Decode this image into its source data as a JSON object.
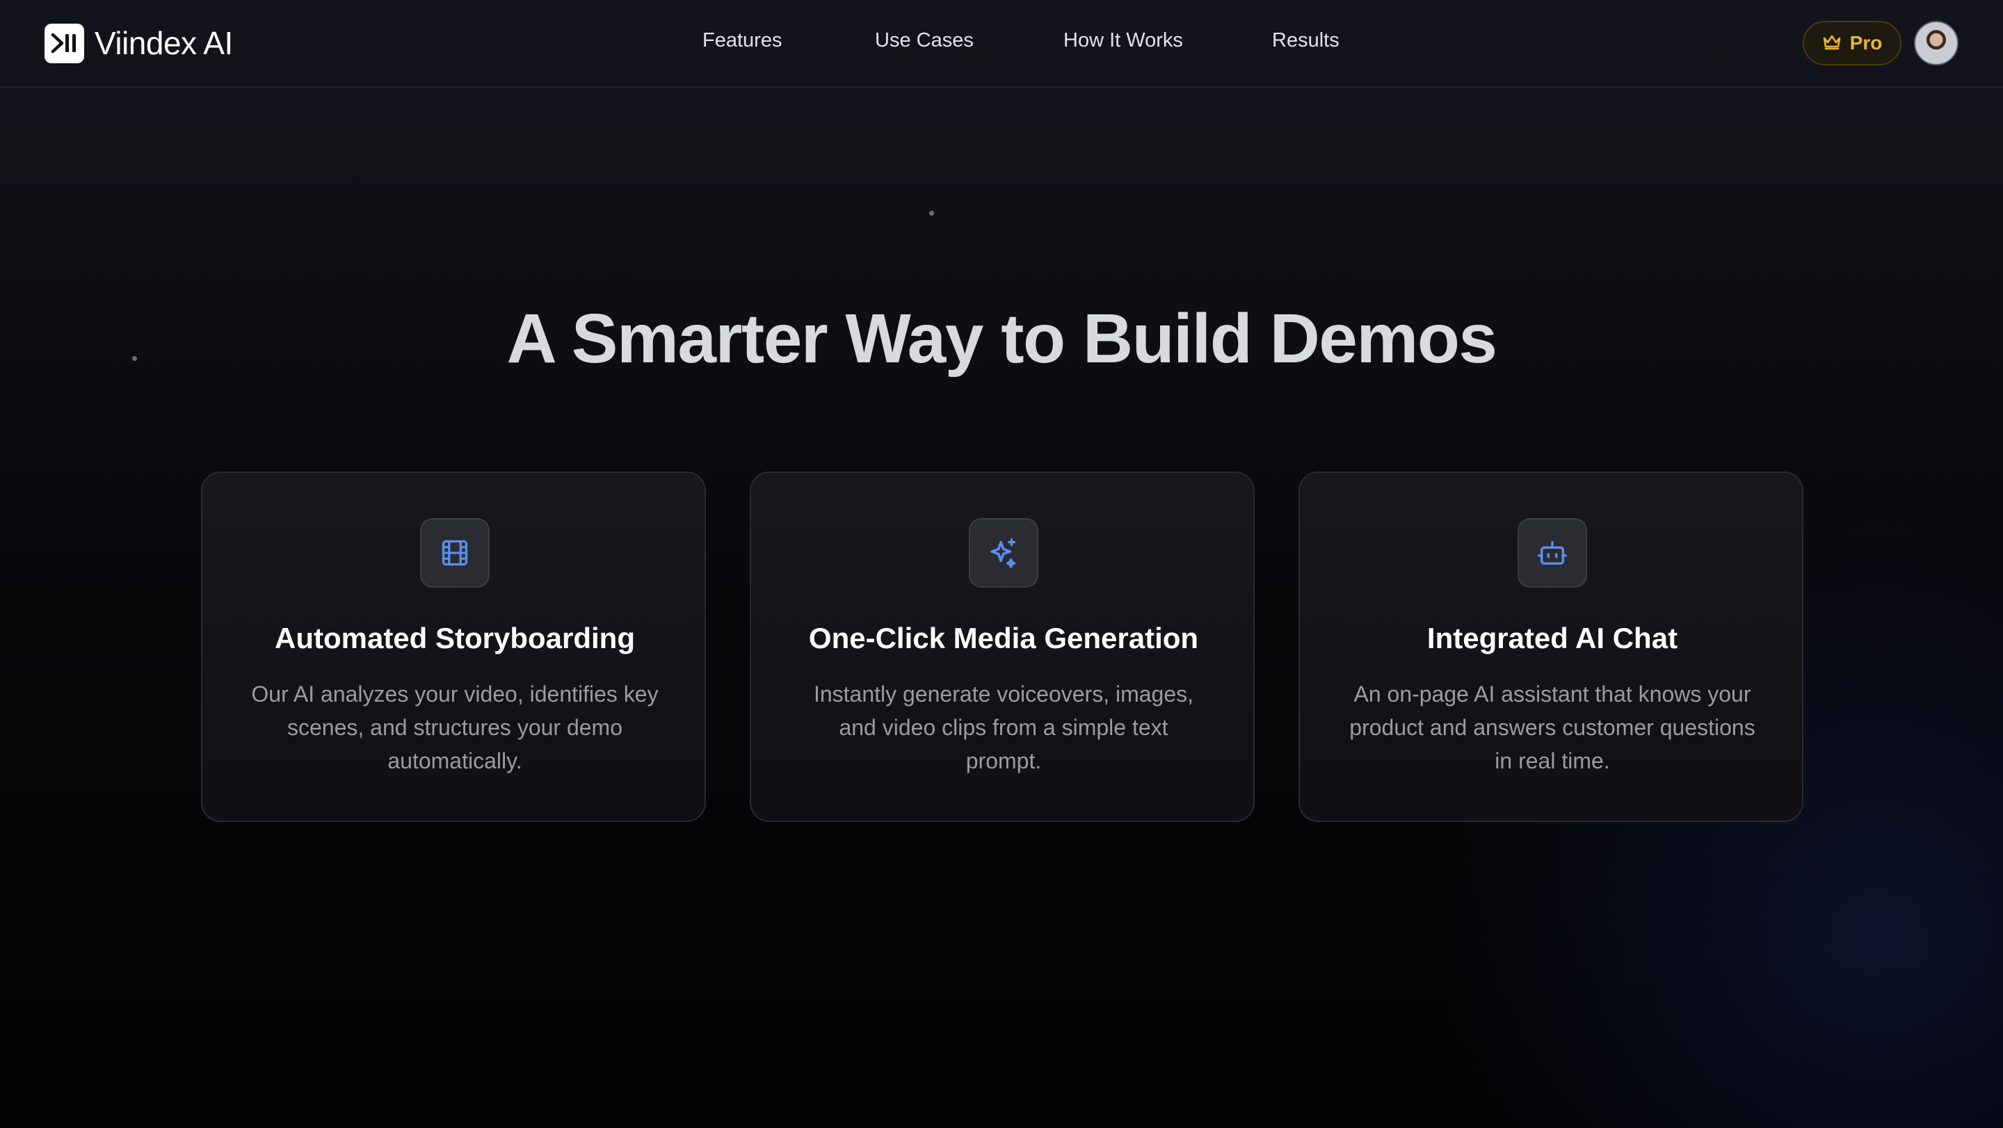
{
  "header": {
    "brand_name": "Viindex AI",
    "brand_icon": "play-pause-logo-icon",
    "nav": [
      {
        "label": "Features"
      },
      {
        "label": "Use Cases"
      },
      {
        "label": "How It Works"
      },
      {
        "label": "Results"
      }
    ],
    "pro_badge": {
      "label": "Pro",
      "icon": "crown-icon",
      "color": "#e9b632"
    }
  },
  "hero": {
    "title": "A Smarter Way to Build Demos"
  },
  "features": [
    {
      "icon": "film-icon",
      "title": "Automated Storyboarding",
      "description": "Our AI analyzes your video, identifies key scenes, and structures your demo automatically."
    },
    {
      "icon": "sparkles-icon",
      "title": "One-Click Media Generation",
      "description": "Instantly generate voiceovers, images, and video clips from a simple text prompt."
    },
    {
      "icon": "bot-icon",
      "title": "Integrated AI Chat",
      "description": "An on-page AI assistant that knows your product and answers customer questions in real time."
    }
  ],
  "theme": {
    "icon_accent": "#5b8ef0",
    "background": "#050507"
  }
}
